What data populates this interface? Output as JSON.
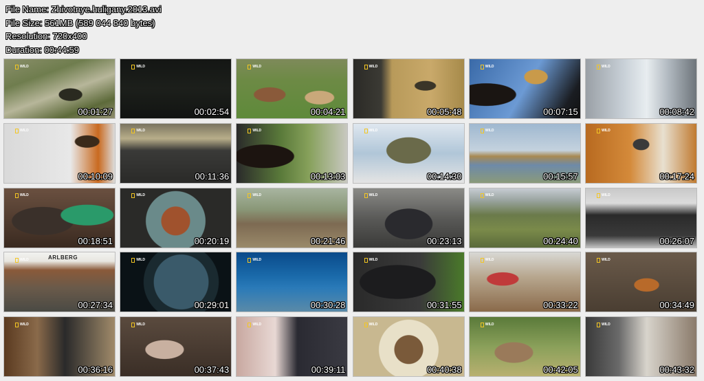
{
  "file_info": {
    "file_name": "File Name: Zhivotnye.huligany.2013.avi",
    "file_size": "File Size: 561MB (589 044 840 bytes)",
    "resolution": "Resolution: 720x400",
    "duration": "Duration: 00:44:59"
  },
  "logo_text": "WILD",
  "sign_text": "ARLBERG",
  "thumbnails": [
    {
      "time": "00:01:27",
      "scene": "chimp-jungle"
    },
    {
      "time": "00:02:54",
      "scene": "dark"
    },
    {
      "time": "00:04:21",
      "scene": "deer-grass"
    },
    {
      "time": "00:05:48",
      "scene": "cheetah-jeep"
    },
    {
      "time": "00:07:15",
      "scene": "cheetah-sky"
    },
    {
      "time": "00:08:42",
      "scene": "window-house"
    },
    {
      "time": "00:10:09",
      "scene": "monkey-shelf"
    },
    {
      "time": "00:11:36",
      "scene": "car-dashboard"
    },
    {
      "time": "00:13:03",
      "scene": "woman-car"
    },
    {
      "time": "00:14:30",
      "scene": "man-hood"
    },
    {
      "time": "00:15:57",
      "scene": "giraffes"
    },
    {
      "time": "00:17:24",
      "scene": "raccoon-cabinet"
    },
    {
      "time": "00:18:51",
      "scene": "bear-towel"
    },
    {
      "time": "00:20:19",
      "scene": "orangutan-round"
    },
    {
      "time": "00:21:46",
      "scene": "workers-orange"
    },
    {
      "time": "00:23:13",
      "scene": "sea-lion"
    },
    {
      "time": "00:24:40",
      "scene": "aerial"
    },
    {
      "time": "00:26:07",
      "scene": "bikes-rack"
    },
    {
      "time": "00:27:34",
      "scene": "arlberg-street"
    },
    {
      "time": "00:29:01",
      "scene": "porthole"
    },
    {
      "time": "00:30:28",
      "scene": "diver"
    },
    {
      "time": "00:31:55",
      "scene": "gorilla"
    },
    {
      "time": "00:33:22",
      "scene": "woman-goat"
    },
    {
      "time": "00:34:49",
      "scene": "fox-wall"
    },
    {
      "time": "00:36:16",
      "scene": "shop-interior"
    },
    {
      "time": "00:37:43",
      "scene": "rubble"
    },
    {
      "time": "00:39:11",
      "scene": "window-interior"
    },
    {
      "time": "00:40:38",
      "scene": "porthole-animal"
    },
    {
      "time": "00:42:05",
      "scene": "rat-grass"
    },
    {
      "time": "00:43:32",
      "scene": "people-street"
    }
  ]
}
